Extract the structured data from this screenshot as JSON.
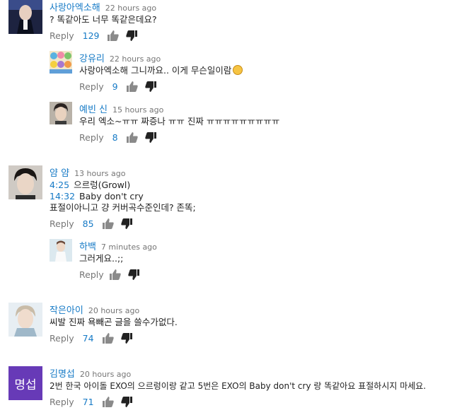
{
  "comments": [
    {
      "author": "사랑아엑소해",
      "time": "22 hours ago",
      "text": "? 똑같아도 너무 똑같은데요?",
      "reply_label": "Reply",
      "likes": "129",
      "replies": [
        {
          "author": "강유리",
          "time": "22 hours ago",
          "text": "사랑아엑소해 그니까요.. 이게 무슨일이람",
          "reply_label": "Reply",
          "likes": "9"
        },
        {
          "author": "예빈 신",
          "time": "15 hours ago",
          "text": "우리 엑소~ㅠㅠ 짜증나 ㅠㅠ 진짜 ㅠㅠㅠㅠㅠㅠㅠㅠㅠ",
          "reply_label": "Reply",
          "likes": "8"
        }
      ]
    },
    {
      "author": "얌 얌",
      "time": "13 hours ago",
      "line1_ts": "4:25",
      "line1_text": "으르렁(Growl)",
      "line2_ts": "14:32",
      "line2_text": "Baby don't cry",
      "line3_text": "표절이아니고 걍 커버곡수준인데? 존똑;",
      "reply_label": "Reply",
      "likes": "85",
      "replies": [
        {
          "author": "하백",
          "time": "7 minutes ago",
          "text": "그러게요..;;",
          "reply_label": "Reply",
          "likes": ""
        }
      ]
    },
    {
      "author": "작은아이",
      "time": "20 hours ago",
      "text": "씨발 진짜 욕빼곤 글을 쓸수가없다.",
      "reply_label": "Reply",
      "likes": "74"
    },
    {
      "author": "김명섭",
      "time": "20 hours ago",
      "avatar_text": "명섭",
      "text": "2번 한국 아이돌 EXO의 으르렁이랑 같고 5번은 EXO의 Baby don't cry 랑 똑같아요 표절하시지 마세요.",
      "reply_label": "Reply",
      "likes": "71"
    }
  ],
  "colors": {
    "link": "#167ac6",
    "meta": "#767676",
    "avatar_purple": "#673ab7"
  }
}
